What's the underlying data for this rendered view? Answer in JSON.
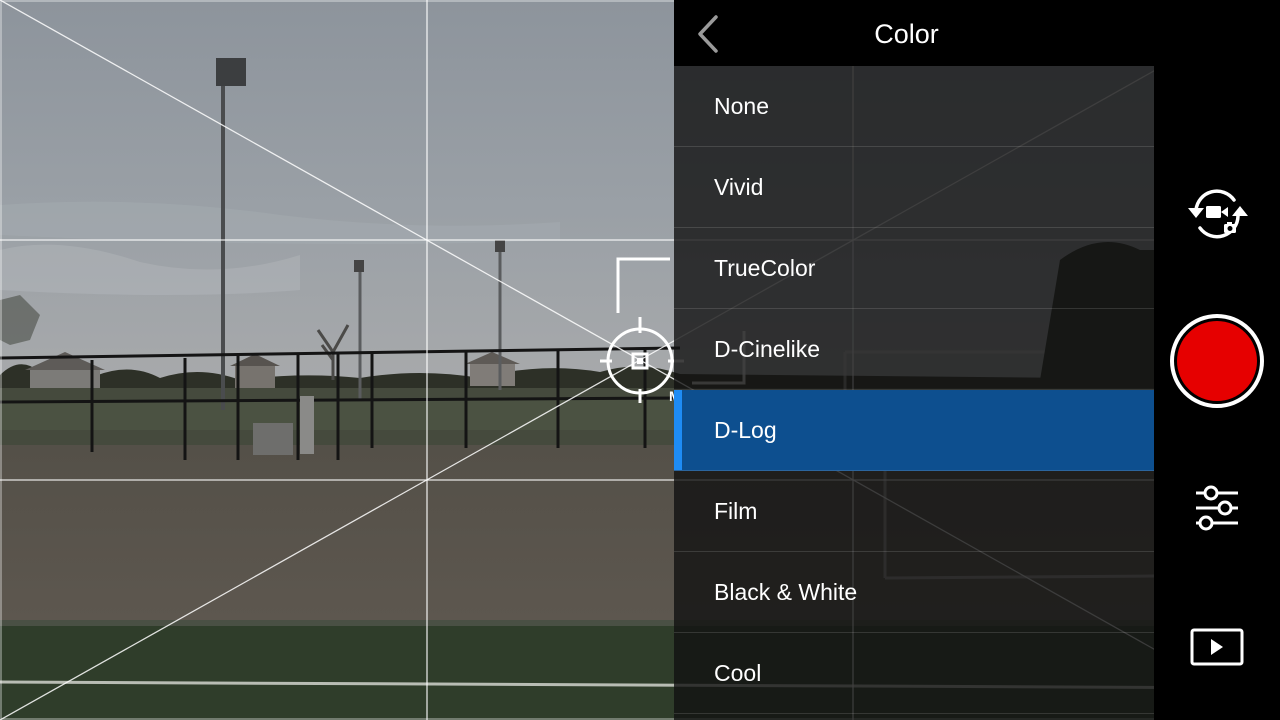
{
  "panel": {
    "title": "Color",
    "options": [
      "None",
      "Vivid",
      "TrueColor",
      "D-Cinelike",
      "D-Log",
      "Film",
      "Black & White",
      "Cool"
    ],
    "selected": "D-Log"
  },
  "focus": {
    "label": "MF"
  },
  "controls": {
    "record_color": "#e60000",
    "icons": [
      "camera-video-switch-icon",
      "record-icon",
      "adjust-sliders-icon",
      "playback-icon"
    ]
  },
  "colors": {
    "selected_bg": "#0d4f8f",
    "selected_accent": "#1e8cf5"
  }
}
